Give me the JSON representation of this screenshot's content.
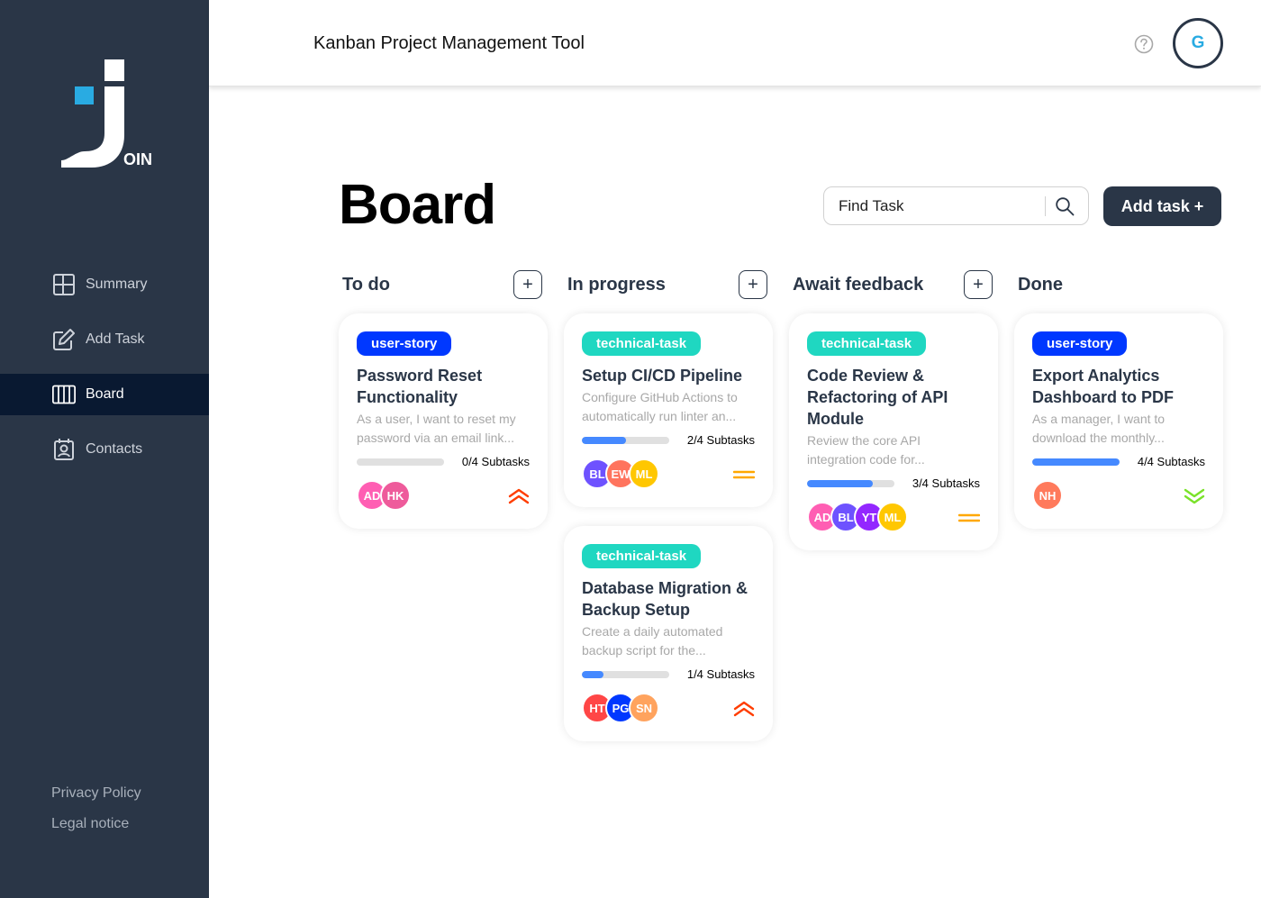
{
  "app": {
    "header_title": "Kanban Project Management Tool",
    "logo_text": "OIN",
    "user_initial": "G"
  },
  "nav": {
    "items": [
      {
        "label": "Summary",
        "icon": "summary-icon"
      },
      {
        "label": "Add Task",
        "icon": "add-task-icon"
      },
      {
        "label": "Board",
        "icon": "board-icon",
        "active": true
      },
      {
        "label": "Contacts",
        "icon": "contacts-icon"
      }
    ],
    "privacy": "Privacy Policy",
    "legal": "Legal notice"
  },
  "board": {
    "title": "Board",
    "search_placeholder": "Find Task",
    "add_task_label": "Add task +"
  },
  "columns": [
    {
      "title": "To do",
      "plus": "+"
    },
    {
      "title": "In progress",
      "plus": "+"
    },
    {
      "title": "Await feedback",
      "plus": "+"
    },
    {
      "title": "Done"
    }
  ],
  "cards": {
    "c1": {
      "tag": "user-story",
      "title": "Password Reset Functionality",
      "desc": "As a user, I want to reset my password via an email link...",
      "subtasks": "0/4 Subtasks",
      "progress": 0.0,
      "assignees": [
        {
          "initials": "AD",
          "color": "#ff5eb3"
        },
        {
          "initials": "HK",
          "color": "#ee5b9b"
        }
      ],
      "priority": "urgent-icon"
    },
    "c2": {
      "tag": "technical-task",
      "title": "Setup CI/CD Pipeline",
      "desc": "Configure GitHub Actions to automatically run linter an...",
      "subtasks": "2/4 Subtasks",
      "progress": 0.5,
      "assignees": [
        {
          "initials": "BL",
          "color": "#6e52ff"
        },
        {
          "initials": "EW",
          "color": "#ff745e"
        },
        {
          "initials": "ML",
          "color": "#ffc701"
        }
      ],
      "priority": "medium-icon"
    },
    "c3": {
      "tag": "technical-task",
      "title": "Database Migration & Backup Setup",
      "desc": "Create a daily automated backup script for the...",
      "subtasks": "1/4 Subtasks",
      "progress": 0.25,
      "assignees": [
        {
          "initials": "HT",
          "color": "#ff4646"
        },
        {
          "initials": "PG",
          "color": "#0038ff"
        },
        {
          "initials": "SN",
          "color": "#ffa35e"
        }
      ],
      "priority": "urgent-icon"
    },
    "c4": {
      "tag": "technical-task",
      "title": "Code Review & Refactoring of API Module",
      "desc": "Review the core API integration code for...",
      "subtasks": "3/4 Subtasks",
      "progress": 0.75,
      "assignees": [
        {
          "initials": "AD",
          "color": "#ff5eb3"
        },
        {
          "initials": "BL",
          "color": "#6e52ff"
        },
        {
          "initials": "YT",
          "color": "#9327ff"
        },
        {
          "initials": "ML",
          "color": "#ffc701"
        }
      ],
      "priority": "medium-icon"
    },
    "c5": {
      "tag": "user-story",
      "title": "Export Analytics Dashboard to PDF",
      "desc": "As a manager, I want to download the monthly...",
      "subtasks": "4/4 Subtasks",
      "progress": 1.0,
      "assignees": [
        {
          "initials": "NH",
          "color": "#ff7a5c"
        }
      ],
      "priority": "low-icon"
    }
  },
  "colors": {
    "sidebar": "#2a3647",
    "active_nav": "#091931",
    "user_story": "#0038ff",
    "technical_task": "#1fd7c1",
    "progress": "#4589ff",
    "urgent": "#ff3d00",
    "medium": "#ffa800",
    "low": "#7ae229"
  }
}
